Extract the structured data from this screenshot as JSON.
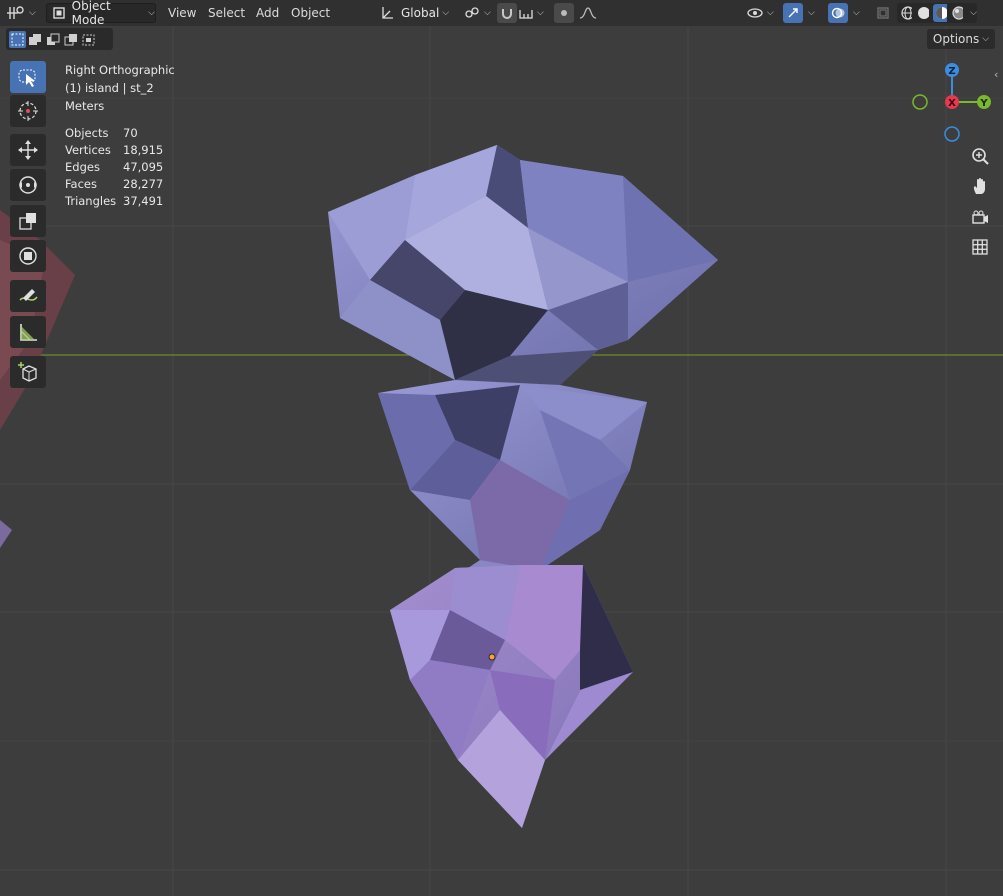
{
  "header": {
    "mode_label": "Object Mode",
    "menus": [
      "View",
      "Select",
      "Add",
      "Object"
    ],
    "transform_orientation": "Global"
  },
  "overlay": {
    "view_name": "Right Orthographic",
    "collection": "(1) island | st_2",
    "units": "Meters"
  },
  "stats": [
    {
      "label": "Objects",
      "value": "70"
    },
    {
      "label": "Vertices",
      "value": "18,915"
    },
    {
      "label": "Edges",
      "value": "47,095"
    },
    {
      "label": "Faces",
      "value": "28,277"
    },
    {
      "label": "Triangles",
      "value": "37,491"
    }
  ],
  "options_label": "Options",
  "gizmo": {
    "z": "Z",
    "x": "X",
    "y": "Y"
  },
  "colors": {
    "accent": "#4772b3",
    "x_axis": "#e8384f",
    "y_axis": "#7ab82e",
    "z_axis": "#3b8de0",
    "mesh": "#8688c8"
  },
  "icons": {
    "toolbar": [
      "select-box-icon",
      "cursor-icon",
      "move-icon",
      "rotate-icon",
      "scale-icon",
      "transform-icon",
      "annotate-icon",
      "measure-icon",
      "add-cube-icon"
    ],
    "nav": [
      "zoom-icon",
      "hand-pan-icon",
      "camera-icon",
      "grid-icon"
    ]
  }
}
